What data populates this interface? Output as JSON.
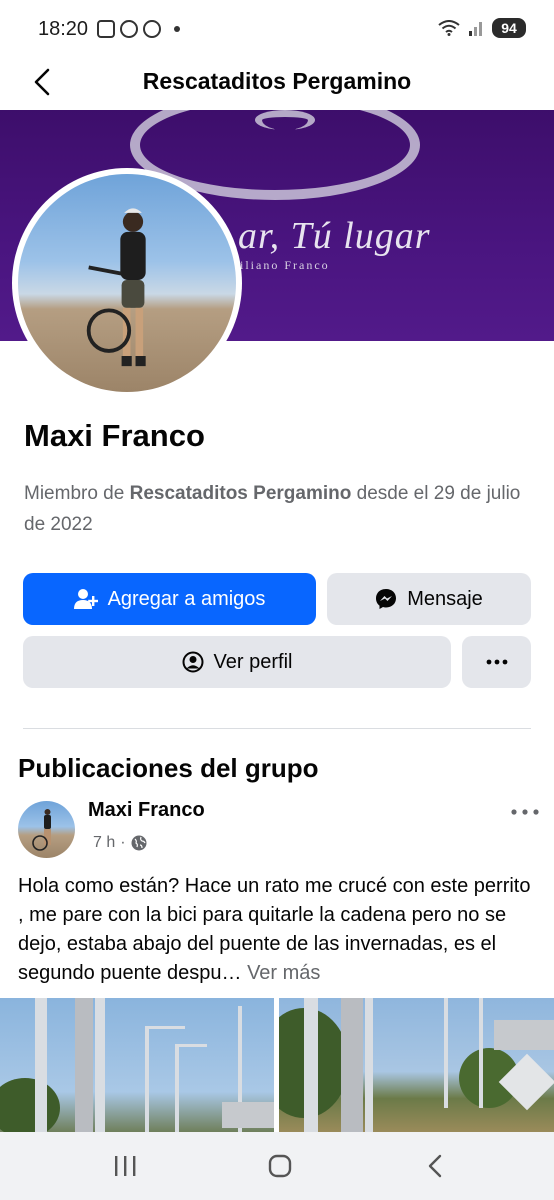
{
  "status_bar": {
    "time": "18:20",
    "battery": "94"
  },
  "header": {
    "title": "Rescataditos Pergamino"
  },
  "cover": {
    "text": "ar, Tú lugar",
    "subtitle": "iliano Franco"
  },
  "profile": {
    "name": "Maxi Franco",
    "member_prefix": "Miembro de ",
    "group_name": "Rescataditos Pergamino",
    "member_suffix": " desde el 29 de julio de 2022"
  },
  "actions": {
    "add_friend": "Agregar a amigos",
    "message": "Mensaje",
    "view_profile": "Ver perfil"
  },
  "section": {
    "title": "Publicaciones del grupo"
  },
  "post": {
    "author": "Maxi Franco",
    "time": "7 h",
    "separator": "·",
    "text": "Hola como están? Hace un rato me crucé con este perrito , me pare con la bici para quitarle la cadena pero no se dejo, estaba abajo del puente de las invernadas, es el segundo puente despu…",
    "see_more": " Ver más"
  },
  "colors": {
    "primary": "#0866ff",
    "secondary_button": "#e4e6eb",
    "cover": "#4a1580",
    "muted_text": "#65676b"
  },
  "icons": {
    "back": "arrow-left-icon",
    "add_friend": "person-plus-icon",
    "message": "messenger-icon",
    "profile": "user-circle-icon",
    "more": "ellipsis-icon",
    "privacy": "globe-icon"
  }
}
